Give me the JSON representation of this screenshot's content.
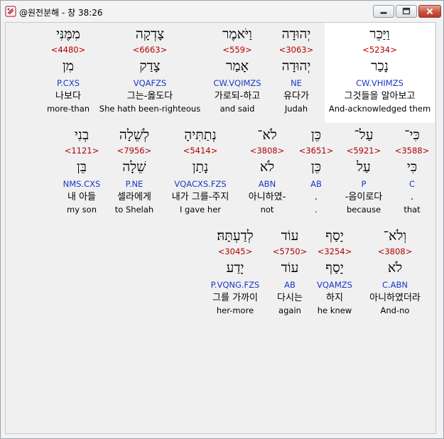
{
  "window": {
    "title": "@원전분해 - 창 38:26"
  },
  "rows": [
    [
      {
        "heb": "וַיַּכֵּר",
        "strong": "<5234>",
        "lemma": "נָכַר",
        "parse": "CW.VHIMZS",
        "kor": "그것들을 알아보고",
        "eng": "And-acknowledged them",
        "selected": true
      },
      {
        "heb": "יְהוּדָה",
        "strong": "<3063>",
        "lemma": "יְהוּדָה",
        "parse": "NE",
        "kor": "유다가",
        "eng": "Judah"
      },
      {
        "heb": "וַיֹּאמֶר",
        "strong": "<559>",
        "lemma": "אָמַר",
        "parse": "CW.VQIMZS",
        "kor": "가로되-하고",
        "eng": "and said"
      },
      {
        "heb": "צָדְקָה",
        "strong": "<6663>",
        "lemma": "צָדַק",
        "parse": "VQAFZS",
        "kor": "그는-옳도다",
        "eng": "She hath been-righteous"
      },
      {
        "heb": "מִמֶּנִּי",
        "strong": "<4480>",
        "lemma": "מִן",
        "parse": "P.CXS",
        "kor": "나보다",
        "eng": "more-than"
      }
    ],
    [
      {
        "heb": "כִּי־",
        "strong": "<3588>",
        "lemma": "כִּי",
        "parse": "C",
        "kor": ".",
        "eng": "that"
      },
      {
        "heb": "עַל־",
        "strong": "<5921>",
        "lemma": "עַל",
        "parse": "P",
        "kor": "-음이로다",
        "eng": "because"
      },
      {
        "heb": "כֵּן",
        "strong": "<3651>",
        "lemma": "כֵּן",
        "parse": "AB",
        "kor": ".",
        "eng": "."
      },
      {
        "heb": "לֹא־",
        "strong": "<3808>",
        "lemma": "לֹא",
        "parse": "ABN",
        "kor": "아니하였-",
        "eng": "not"
      },
      {
        "heb": "נְתַתִּיהָ",
        "strong": "<5414>",
        "lemma": "נָתַן",
        "parse": "VQACXS.FZS",
        "kor": "내가 그를-주지",
        "eng": "I gave her"
      },
      {
        "heb": "לְשֵׁלָה",
        "strong": "<7956>",
        "lemma": "שֵׁלָה",
        "parse": "P.NE",
        "kor": "셀라에게",
        "eng": "to Shelah"
      },
      {
        "heb": "בְנִי",
        "strong": "<1121>",
        "lemma": "בֵּן",
        "parse": "NMS.CXS",
        "kor": "내 아들",
        "eng": "my son"
      }
    ],
    [
      {
        "heb": "וְלֹא־",
        "strong": "<3808>",
        "lemma": "לֹא",
        "parse": "C.ABN",
        "kor": "아니하였더라",
        "eng": "And-no"
      },
      {
        "heb": "יָסַף",
        "strong": "<3254>",
        "lemma": "יָסַף",
        "parse": "VQAMZS",
        "kor": "하지",
        "eng": "he knew"
      },
      {
        "heb": "עוֹד",
        "strong": "<5750>",
        "lemma": "עוֹד",
        "parse": "AB",
        "kor": "다시는",
        "eng": "again"
      },
      {
        "heb": "לְדַעְתָּהּ׃",
        "strong": "<3045>",
        "lemma": "יָדַע",
        "parse": "P.VQNG.FZS",
        "kor": "그를 가까이",
        "eng": "her-more"
      }
    ]
  ]
}
